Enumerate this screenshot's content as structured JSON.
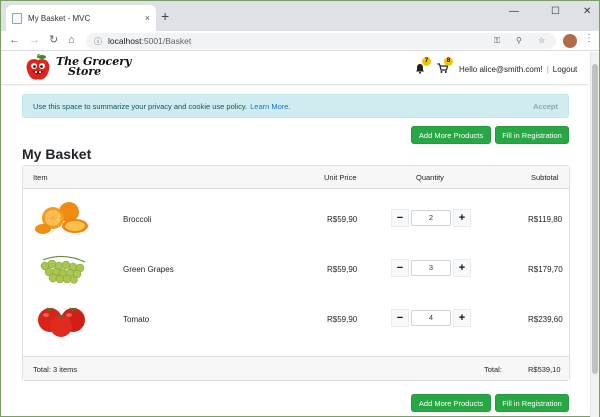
{
  "browser": {
    "tab_title": "My Basket - MVC",
    "tab_close": "×",
    "new_tab": "+",
    "url_host": "localhost",
    "url_rest": ":5001/Basket",
    "controls": {
      "minimize": "—",
      "maximize": "☐",
      "close": "✕"
    }
  },
  "navbar": {
    "logo_line1": "The Grocery",
    "logo_line2": "Store",
    "notifications_count": "7",
    "cart_count": "8",
    "greeting": "Hello alice@smith.com!",
    "separator": "|",
    "logout": "Logout"
  },
  "cookie": {
    "message": "Use this space to summarize your privacy and cookie use policy.",
    "link": "Learn More.",
    "accept": "Accept"
  },
  "actions": {
    "add_more": "Add More Products",
    "fill_registration": "Fill in Registration"
  },
  "basket": {
    "title": "My Basket",
    "headers": {
      "item": "Item",
      "unit_price": "Unit Price",
      "quantity": "Quantity",
      "subtotal": "Subtotal"
    },
    "items": [
      {
        "name": "Broccoli",
        "unit_price": "R$59,90",
        "quantity": "2",
        "subtotal": "R$119,80",
        "image": "oranges"
      },
      {
        "name": "Green Grapes",
        "unit_price": "R$59,90",
        "quantity": "3",
        "subtotal": "R$179,70",
        "image": "grapes"
      },
      {
        "name": "Tomato",
        "unit_price": "R$59,90",
        "quantity": "4",
        "subtotal": "R$239,60",
        "image": "tomatoes"
      }
    ],
    "minus": "−",
    "plus": "+",
    "footer_items": "Total: 3 items",
    "footer_total_label": "Total:",
    "footer_total_value": "R$539,10"
  },
  "colors": {
    "primary_green": "#28a745",
    "info_bg": "#d1ecf1",
    "badge": "#f6c400"
  }
}
